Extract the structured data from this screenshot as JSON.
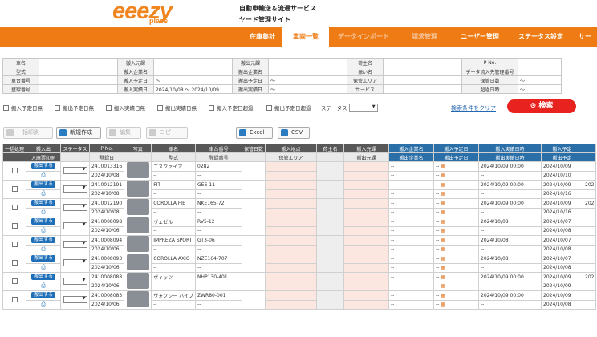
{
  "header": {
    "logo_main": "eeezy",
    "logo_sub": "place",
    "site_line1": "自動車輸送＆流通サービス",
    "site_line2": "ヤード管理サイト"
  },
  "nav": [
    {
      "label": "在庫集計",
      "state": "normal"
    },
    {
      "label": "車両一覧",
      "state": "active"
    },
    {
      "label": "データインポート",
      "state": "dim"
    },
    {
      "label": "請求管理",
      "state": "dim"
    },
    {
      "label": "ユーザー管理",
      "state": "normal"
    },
    {
      "label": "ステータス設定",
      "state": "normal"
    },
    {
      "label": "サー",
      "state": "normal"
    }
  ],
  "filter": [
    [
      "車名",
      "",
      "搬入元課",
      "",
      "搬出元課",
      "",
      "荷主名",
      "",
      "P No.",
      ""
    ],
    [
      "型式",
      "",
      "搬入企業名",
      "",
      "搬出企業名",
      "",
      "振い名",
      "",
      "データ流入先管理番号",
      ""
    ],
    [
      "車台番号",
      "",
      "搬入予定日",
      "～",
      "搬出予定日",
      "～",
      "保管エリア",
      "",
      "保管日数",
      "～"
    ],
    [
      "登録番号",
      "",
      "搬入実績日",
      "2024/10/08 ～ 2024/10/09",
      "搬出実績日",
      "～",
      "サービス",
      "",
      "超過日時",
      "～"
    ]
  ],
  "checks": [
    "搬入予定日無",
    "搬出予定日無",
    "搬入実績日無",
    "搬出実績日無",
    "搬入予定日超過",
    "搬出予定日超過"
  ],
  "status_label": "ステータス",
  "clear_label": "検索条件をクリア",
  "search_label": "検索",
  "toolbar": {
    "print": "一括印刷",
    "create": "新規作成",
    "edit": "編集",
    "copy": "コピー",
    "excel": "Excel",
    "csv": "CSV"
  },
  "columns_top": [
    "一括処理",
    "搬入出",
    "ステータス",
    "P No.",
    "写真",
    "車名",
    "車台番号",
    "保管日数",
    "搬入地点",
    "荷主名",
    "搬入元課",
    "搬入企業名",
    "搬入予定日",
    "搬入実績日時",
    "搬入予定",
    ""
  ],
  "columns_sub": [
    "",
    "入庫票印刷",
    "",
    "登録日",
    "",
    "型式",
    "登録番号",
    "",
    "保管エリア",
    "",
    "搬出元課",
    "搬出企業名",
    "搬出予定日",
    "搬出実績日時",
    "搬出予定",
    ""
  ],
  "rows": [
    {
      "pno": "2410013316",
      "date": "2024/10/08",
      "car": "エスクァイア",
      "model": "--",
      "vin": "0282",
      "reg": "--",
      "in_date": "2024/10/09 00:00",
      "plan": "2024/10/09",
      "out_plan": "2024/10/10",
      "extra": ""
    },
    {
      "pno": "2410012191",
      "date": "2024/10/08",
      "car": "FIT",
      "model": "--",
      "vin": "GE6-11",
      "reg": "--",
      "in_date": "2024/10/09 00:00",
      "plan": "2024/10/09",
      "out_plan": "2024/10/16",
      "extra": "202"
    },
    {
      "pno": "2410012190",
      "date": "2024/10/08",
      "car": "COROLLA FIE",
      "model": "--",
      "vin": "NKE165-72",
      "reg": "--",
      "in_date": "2024/10/09 00:00",
      "plan": "2024/10/09",
      "out_plan": "2024/10/16",
      "extra": "202"
    },
    {
      "pno": "2410008098",
      "date": "2024/10/06",
      "car": "ヴェゼル",
      "model": "--",
      "vin": "RV5-12",
      "reg": "--",
      "in_date": "2024/10/08",
      "plan": "2024/10/07",
      "out_plan": "2024/10/08",
      "extra": ""
    },
    {
      "pno": "2410008094",
      "date": "2024/10/06",
      "car": "IMPREZA SPORT",
      "model": "--",
      "vin": "GT3-06",
      "reg": "--",
      "in_date": "2024/10/08",
      "plan": "2024/10/07",
      "out_plan": "2024/10/08",
      "extra": ""
    },
    {
      "pno": "2410008093",
      "date": "2024/10/06",
      "car": "COROLLA AXIO",
      "model": "--",
      "vin": "NZE164-707",
      "reg": "--",
      "in_date": "2024/10/08",
      "plan": "2024/10/07",
      "out_plan": "2024/10/08",
      "extra": ""
    },
    {
      "pno": "2410008088",
      "date": "2024/10/06",
      "car": "ヴィッツ",
      "model": "--",
      "vin": "NHP130-401",
      "reg": "--",
      "in_date": "2024/10/09 00:00",
      "plan": "2024/10/09",
      "out_plan": "2024/10/09",
      "extra": "202"
    },
    {
      "pno": "2410008083",
      "date": "2024/10/06",
      "car": "ヴォクシー ハイブ",
      "model": "--",
      "vin": "ZWR80-001",
      "reg": "--",
      "in_date": "2024/10/09 00:00",
      "plan": "2024/10/09",
      "out_plan": "2024/10/08",
      "extra": ""
    }
  ],
  "row_btn": "搬出する",
  "colors": {
    "accent": "#ee7b13",
    "header_bg": "#585858",
    "blue_header": "#2b6fa8",
    "search": "#e8231f"
  }
}
